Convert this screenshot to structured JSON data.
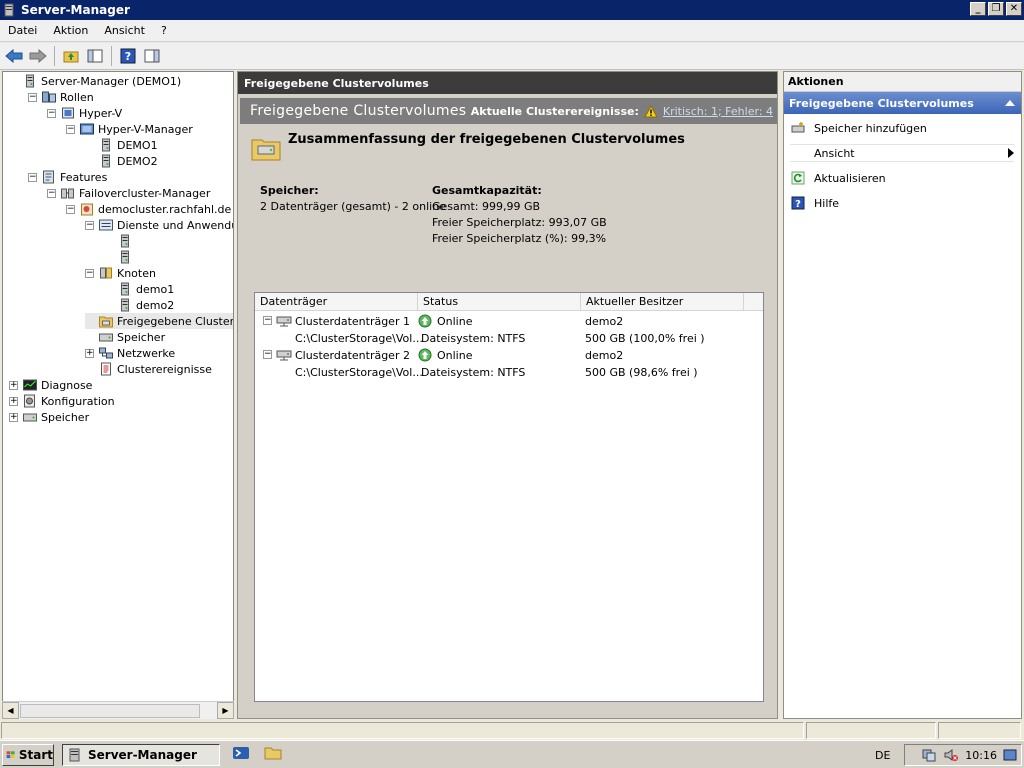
{
  "window": {
    "title": "Server-Manager"
  },
  "menu": [
    "Datei",
    "Aktion",
    "Ansicht",
    "?"
  ],
  "tree": [
    {
      "label": "Server-Manager (DEMO1)",
      "level": 0,
      "exp": "",
      "icon": "server-icon"
    },
    {
      "label": "Rollen",
      "level": 1,
      "exp": "−",
      "icon": "roles-icon"
    },
    {
      "label": "Hyper-V",
      "level": 2,
      "exp": "−",
      "icon": "hyperv-icon"
    },
    {
      "label": "Hyper-V-Manager",
      "level": 3,
      "exp": "−",
      "icon": "hyperv-manager-icon"
    },
    {
      "label": "DEMO1",
      "level": 4,
      "exp": "",
      "icon": "server-icon"
    },
    {
      "label": "DEMO2",
      "level": 4,
      "exp": "",
      "icon": "server-icon"
    },
    {
      "label": "Features",
      "level": 1,
      "exp": "−",
      "icon": "features-icon"
    },
    {
      "label": "Failovercluster-Manager",
      "level": 2,
      "exp": "−",
      "icon": "cluster-manager-icon"
    },
    {
      "label": "democluster.rachfahl.de",
      "level": 3,
      "exp": "−",
      "icon": "cluster-icon"
    },
    {
      "label": "Dienste und Anwendungen",
      "level": 4,
      "exp": "−",
      "icon": "services-icon"
    },
    {
      "label": "",
      "level": 5,
      "exp": "",
      "icon": "server-icon"
    },
    {
      "label": "",
      "level": 5,
      "exp": "",
      "icon": "server-icon"
    },
    {
      "label": "Knoten",
      "level": 4,
      "exp": "−",
      "icon": "nodes-icon"
    },
    {
      "label": "demo1",
      "level": 5,
      "exp": "",
      "icon": "server-icon"
    },
    {
      "label": "demo2",
      "level": 5,
      "exp": "",
      "icon": "server-icon"
    },
    {
      "label": "Freigegebene Clustervolum",
      "level": 4,
      "exp": "",
      "icon": "shared-volumes-icon",
      "selected": true
    },
    {
      "label": "Speicher",
      "level": 4,
      "exp": "",
      "icon": "storage-icon"
    },
    {
      "label": "Netzwerke",
      "level": 4,
      "exp": "+",
      "icon": "network-icon"
    },
    {
      "label": "Clusterereignisse",
      "level": 4,
      "exp": "",
      "icon": "events-icon"
    },
    {
      "label": "Diagnose",
      "level": 0,
      "exp": "+",
      "icon": "diagnostics-icon"
    },
    {
      "label": "Konfiguration",
      "level": 0,
      "exp": "+",
      "icon": "configuration-icon"
    },
    {
      "label": "Speicher",
      "level": 0,
      "exp": "+",
      "icon": "storage-icon"
    }
  ],
  "center": {
    "header": "Freigegebene Clustervolumes",
    "pane_title": "Freigegebene Clustervolumes",
    "events_label": "Aktuelle Clusterereignisse:",
    "events_link": "Kritisch: 1; Fehler: 4",
    "summary_title": "Zusammenfassung der freigegebenen Clustervolumes",
    "storage_label": "Speicher:",
    "storage_value": "2 Datenträger (gesamt) - 2 online",
    "capacity_label": "Gesamtkapazität:",
    "capacity_total": "Gesamt: 999,99 GB",
    "capacity_free": "Freier Speicherplatz: 993,07 GB",
    "capacity_free_pct": "Freier Speicherplatz (%): 99,3%",
    "columns": [
      "Datenträger",
      "Status",
      "Aktueller Besitzer"
    ],
    "disks": [
      {
        "name": "Clusterdatenträger 1",
        "status": "Online",
        "owner": "demo2",
        "path": "C:\\ClusterStorage\\Vol...",
        "fs": "Dateisystem: NTFS",
        "size": "500 GB (100,0% frei )"
      },
      {
        "name": "Clusterdatenträger 2",
        "status": "Online",
        "owner": "demo2",
        "path": "C:\\ClusterStorage\\Vol...",
        "fs": "Dateisystem: NTFS",
        "size": "500 GB (98,6% frei )"
      }
    ]
  },
  "actions": {
    "header": "Aktionen",
    "section": "Freigegebene Clustervolumes",
    "items": [
      {
        "label": "Speicher hinzufügen",
        "icon": "add-storage-icon"
      },
      {
        "label": "Ansicht",
        "icon": "",
        "submenu": true
      },
      {
        "label": "Aktualisieren",
        "icon": "refresh-icon"
      },
      {
        "label": "Hilfe",
        "icon": "help-icon"
      }
    ]
  },
  "taskbar": {
    "start": "Start",
    "app": "Server-Manager",
    "lang": "DE",
    "time": "10:16"
  }
}
